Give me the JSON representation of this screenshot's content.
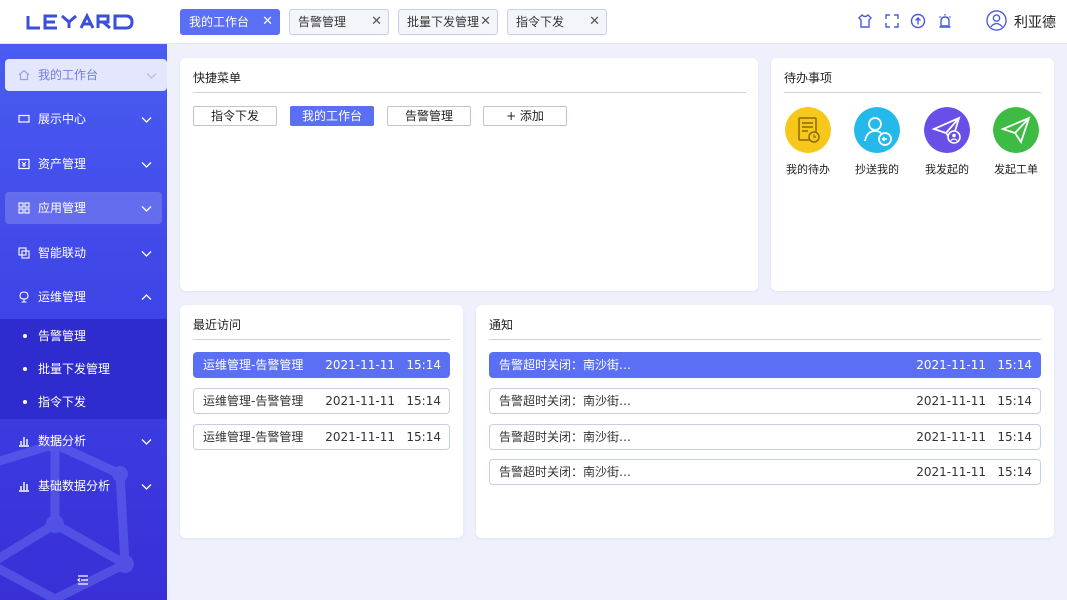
{
  "app": {
    "logo": "LEYARD",
    "user_name": "利亚德"
  },
  "tabs": [
    {
      "label": "我的工作台",
      "active": true
    },
    {
      "label": "告警管理",
      "active": false
    },
    {
      "label": "批量下发管理",
      "active": false
    },
    {
      "label": "指令下发",
      "active": false
    }
  ],
  "toolbar_icons": [
    "shirt-icon",
    "fullscreen-icon",
    "upload-icon",
    "alarm-icon"
  ],
  "sidebar": {
    "items": [
      {
        "label": "我的工作台",
        "icon": "home-icon"
      },
      {
        "label": "展示中心",
        "icon": "monitor-icon"
      },
      {
        "label": "资产管理",
        "icon": "asset-icon"
      },
      {
        "label": "应用管理",
        "icon": "grid-icon"
      },
      {
        "label": "智能联动",
        "icon": "link-icon"
      },
      {
        "label": "运维管理",
        "icon": "maintenance-icon"
      },
      {
        "label": "数据分析",
        "icon": "bar-chart-icon"
      },
      {
        "label": "基础数据分析",
        "icon": "bar-chart-icon"
      }
    ],
    "sub_items": [
      {
        "label": "告警管理"
      },
      {
        "label": "批量下发管理"
      },
      {
        "label": "指令下发"
      }
    ]
  },
  "quick_menu": {
    "title": "快捷菜单",
    "buttons": [
      {
        "label": "指令下发"
      },
      {
        "label": "我的工作台"
      },
      {
        "label": "告警管理"
      },
      {
        "label": "+ 添加"
      }
    ]
  },
  "todo": {
    "title": "待办事项",
    "items": [
      {
        "label": "我的待办",
        "color": "#f7c81b"
      },
      {
        "label": "抄送我的",
        "color": "#25b8ea"
      },
      {
        "label": "我发起的",
        "color": "#6a4ee8"
      },
      {
        "label": "发起工单",
        "color": "#3dbb44"
      }
    ]
  },
  "recent": {
    "title": "最近访问",
    "rows": [
      {
        "text": "运维管理-告警管理",
        "date": "2021-11-11   15:14"
      },
      {
        "text": "运维管理-告警管理",
        "date": "2021-11-11   15:14"
      },
      {
        "text": "运维管理-告警管理",
        "date": "2021-11-11   15:14"
      }
    ]
  },
  "notice": {
    "title": "通知",
    "rows": [
      {
        "text": "告警超时关闭：南沙街…",
        "date": "2021-11-11   15:14"
      },
      {
        "text": "告警超时关闭：南沙街…",
        "date": "2021-11-11   15:14"
      },
      {
        "text": "告警超时关闭：南沙街…",
        "date": "2021-11-11   15:14"
      },
      {
        "text": "告警超时关闭：南沙街…",
        "date": "2021-11-11   15:14"
      }
    ]
  },
  "colors": {
    "accent": "#5b6ff5",
    "sidebar": "#3b3ee3"
  }
}
